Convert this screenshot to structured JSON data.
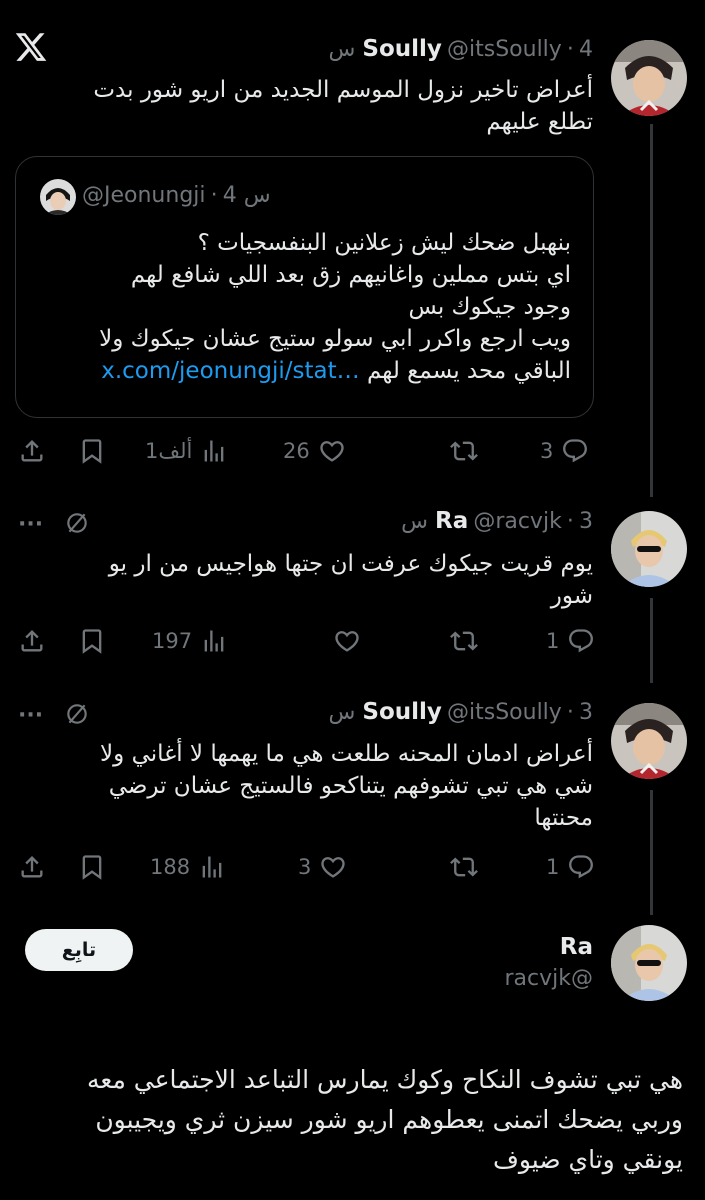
{
  "tweet1": {
    "name": "Soully",
    "handle": "@itsSoully",
    "time": "4 س",
    "text_line1": "أعراض تاخير نزول الموسم الجديد من اريو شور بدت",
    "text_line2": "تطلع عليهم",
    "quote": {
      "handle": "@Jeonungji",
      "time": "4 س",
      "line1": "بنهبل ضحك ليش زعلانين البنفسجيات ؟",
      "line2": "اي بتس مملين واغانيهم زق بعد اللي شافع لهم",
      "line3": "وجود جيكوك بس",
      "line4": "ويب ارجع واكرر ابي سولو ستيج عشان جيكوك ولا",
      "line5_text": "الباقي محد يسمع لهم",
      "line5_link": "x.com/jeonungji/stat…"
    },
    "views": "1ألف",
    "likes": "26",
    "retweets": "",
    "replies": "3"
  },
  "tweet2": {
    "name": "Ra",
    "handle": "@racvjk",
    "time": "3 س",
    "text_line1": "يوم قريت جيكوك عرفت ان جتها هواجيس من ار يو",
    "text_line2": "شور",
    "views": "197",
    "likes": "",
    "retweets": "",
    "replies": "1"
  },
  "tweet3": {
    "name": "Soully",
    "handle": "@itsSoully",
    "time": "3 س",
    "text_line1": "أعراض ادمان المحنه طلعت هي ما يهمها لا أغاني ولا",
    "text_line2": "شي هي تبي تشوفهم يتناكحو فالستيج عشان ترضي",
    "text_line3": "محنتها",
    "views": "188",
    "likes": "3",
    "retweets": "",
    "replies": "1"
  },
  "main": {
    "name": "Ra",
    "handle": "@racvjk",
    "follow_label": "تابِع",
    "text_line1": "هي تبي تشوف النكاح وكوك يمارس التباعد الاجتماعي معه",
    "text_line2": "وربي يضحك اتمنى يعطوهم اريو شور سيزن ثري ويجيبون",
    "text_line3": "يونقي وتاي ضيوف"
  },
  "colors": {
    "background": "#000000",
    "text": "#e7e9ea",
    "muted": "#71767b",
    "link": "#1d9bf0",
    "follow_bg": "#eff3f4"
  }
}
